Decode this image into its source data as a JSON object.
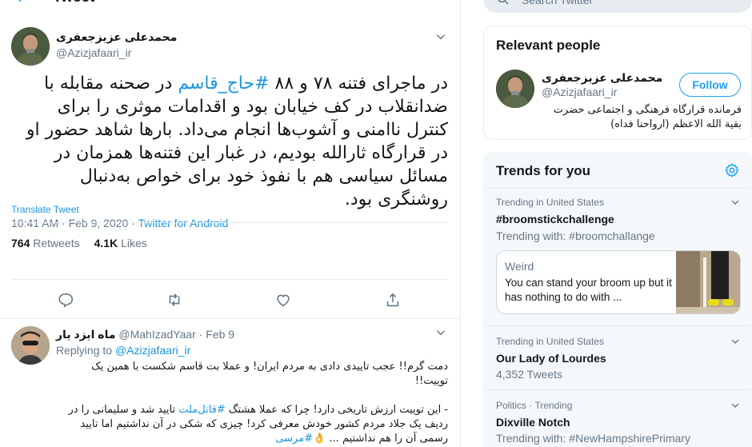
{
  "tweet_view": {
    "title": "Tweet",
    "author_name": "محمدعلی عزیزجعفری",
    "author_handle": "@Azizjafaari_ir",
    "text_before_hashtag": "در ماجرای فتنه ۷۸ و ۸۸ ",
    "hashtag": "#حاج_قاسم",
    "text_after_hashtag": " در صحنه مقابله با ضدانقلاب در کف خیابان بود و اقدامات موثری را برای کنترل ناامنی و آشوب‌ها انجام می‌داد. بارها شاهد حضور او در قرارگاه ثارالله بودیم، در غبار این فتنه‌ها همزمان در مسائل سیاسی هم با نفوذ خود برای خواص به‌دنبال روشنگری بود.",
    "translate_label": "Translate Tweet",
    "timestamp": "10:41 AM · Feb 9, 2020 · ",
    "source": "Twitter for Android",
    "retweets_count": "764",
    "retweets_label": " Retweets",
    "likes_count": "4.1K",
    "likes_label": " Likes"
  },
  "reply": {
    "author_name": "ماه ایزد یار",
    "handle_time": " @MahIzadYaar · Feb 9",
    "replying_label": "Replying to ",
    "replying_to": "@Azizjafaari_ir",
    "line1": "دمت گرم!! عجب تاییدی دادی به مردم ایران! و عملا بت قاسم شکست با همین یک توییت!!",
    "line2_prefix": "- این توییت ارزش تاریخی دارد! چرا که عملا هشتگ ",
    "line2_hashtag": "#قاتل‌ملت",
    "line2_suffix": " تایید شد و سلیمانی را در ردیف یک جلاد مردم کشور خودش معرفی کرد! چیزی که شکی در آن نداشتیم اما تایید رسمی آن را هم نداشتیم ... ",
    "line2_emoji": "👌",
    "line2_end_hashtag": "#مرسی"
  },
  "sidebar": {
    "search_placeholder": "Search Twitter",
    "relevant_title": "Relevant people",
    "person_name": "محمدعلی عزیزجعفری",
    "person_handle": "@Azizjafaari_ir",
    "follow_label": "Follow",
    "person_bio": "فرمانده قرارگاه فرهنگی و اجتماعی حضرت بقیة الله الاعظم (ارواحنا فداه)",
    "trends_title": "Trends for you",
    "trends": [
      {
        "meta": "Trending in United States",
        "name": "#broomstickchallenge",
        "sub": "Trending with: #broomchallange"
      },
      {
        "meta": "Trending in United States",
        "name": "Our Lady of Lourdes",
        "sub": "4,352 Tweets"
      },
      {
        "meta": "Politics · Trending",
        "name": "Dixville Notch",
        "sub": "Trending with: #NewHampshirePrimary"
      }
    ],
    "news": {
      "category": "Weird",
      "text": "You can stand your broom up but it has nothing to do with ..."
    }
  },
  "colors": {
    "accent": "#1da1f2",
    "link": "#1b95e0",
    "muted": "#657786",
    "border": "#e6ecf0"
  }
}
